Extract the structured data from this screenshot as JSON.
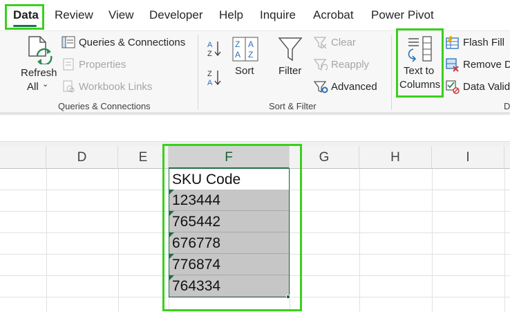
{
  "tabs": [
    "Data",
    "Review",
    "View",
    "Developer",
    "Help",
    "Inquire",
    "Acrobat",
    "Power Pivot"
  ],
  "ribbon": {
    "queries_group": {
      "refresh_line1": "Refresh",
      "refresh_line2": "All",
      "queries_connections": "Queries & Connections",
      "properties": "Properties",
      "workbook_links": "Workbook Links",
      "label": "Queries & Connections"
    },
    "sort_group": {
      "sort": "Sort",
      "filter": "Filter",
      "clear": "Clear",
      "reapply": "Reapply",
      "advanced": "Advanced",
      "label": "Sort & Filter"
    },
    "data_tools_group": {
      "text_to_columns_line1": "Text to",
      "text_to_columns_line2": "Columns",
      "flash_fill": "Flash Fill",
      "remove_duplicates": "Remove D",
      "data_validation": "Data Valid",
      "label": "D"
    }
  },
  "sheet": {
    "columns": [
      "D",
      "E",
      "F",
      "G",
      "H",
      "I"
    ],
    "selected_column": "F",
    "header_cell": "SKU Code",
    "values": [
      "123444",
      "765442",
      "676778",
      "776874",
      "764334"
    ]
  },
  "colors": {
    "accent": "#1e7145",
    "highlight": "#39d01c",
    "selection_fill": "#c6c6c6"
  }
}
